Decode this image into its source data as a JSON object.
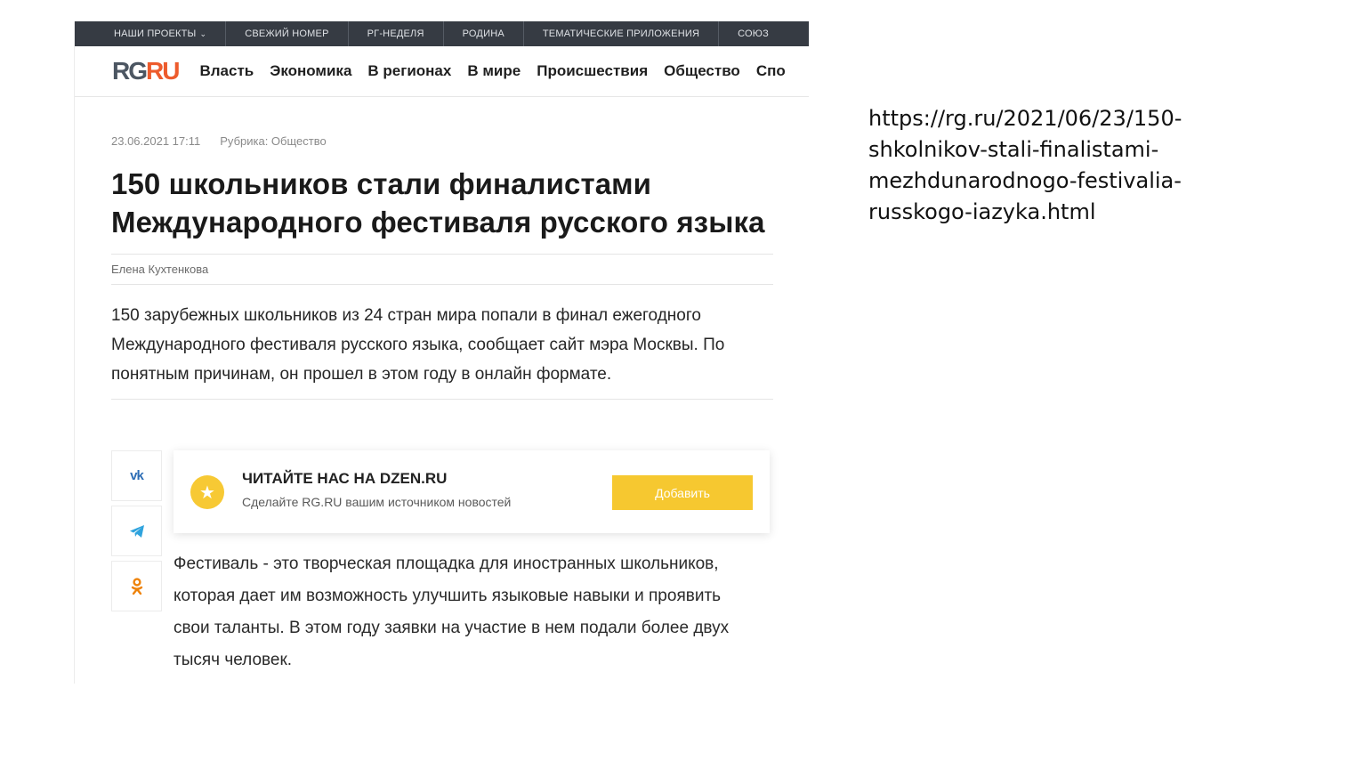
{
  "topbar": {
    "items": [
      "НАШИ ПРОЕКТЫ",
      "СВЕЖИЙ НОМЕР",
      "РГ-НЕДЕЛЯ",
      "РОДИНА",
      "ТЕМАТИЧЕСКИЕ ПРИЛОЖЕНИЯ",
      "СОЮЗ"
    ]
  },
  "logo": {
    "rg": "RG",
    "ru": "RU"
  },
  "nav": {
    "items": [
      "Власть",
      "Экономика",
      "В регионах",
      "В мире",
      "Происшествия",
      "Общество",
      "Спо"
    ]
  },
  "article": {
    "date": "23.06.2021 17:11",
    "rubric": "Рубрика: Общество",
    "title": "150 школьников стали финалистами Международного фестиваля русского языка",
    "author": "Елена Кухтенкова",
    "lead": "150 зарубежных школьников из 24 стран мира попали в финал ежегодного Международного фестиваля русского языка, сообщает сайт мэра Москвы. По понятным причинам, он прошел в этом году в онлайн формате.",
    "body": "Фестиваль - это творческая площадка для иностранных школьников, которая дает им возможность улучшить языковые навыки и проявить свои таланты. В этом году заявки на участие в нем подали более двух тысяч человек."
  },
  "share": {
    "vk_label": "vk"
  },
  "dzen": {
    "title": "ЧИТАЙТЕ НАС НА DZEN.RU",
    "subtitle": "Сделайте RG.RU вашим источником новостей",
    "button": "Добавить"
  },
  "url": "https://rg.ru/2021/06/23/150-shkolnikov-stali-finalistami-mezhdunarodnogo-festivalia-russkogo-iazyka.html",
  "colors": {
    "topbar_bg": "#363b43",
    "logo_rg": "#4c5662",
    "logo_ru": "#ed5b2c",
    "accent_yellow": "#f6c830",
    "vk_blue": "#2c6db5",
    "telegram_blue": "#2fa3dd",
    "ok_orange": "#ee8208"
  }
}
